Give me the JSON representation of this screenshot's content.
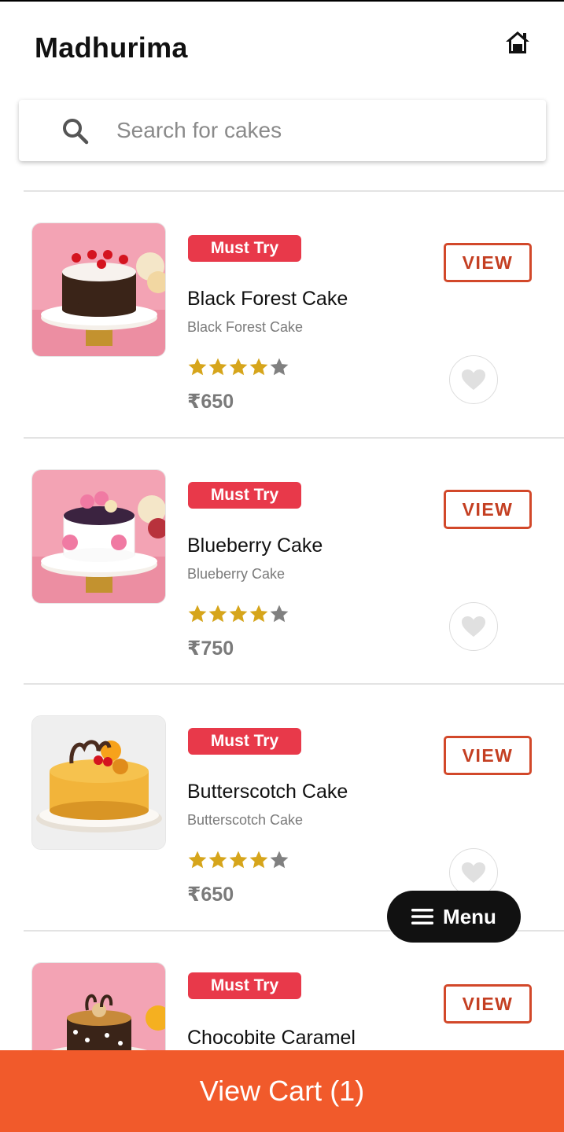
{
  "header": {
    "title": "Madhurima",
    "home_icon": "home-icon"
  },
  "search": {
    "placeholder": "Search for cakes",
    "value": "",
    "icon": "search-icon"
  },
  "colors": {
    "badge": "#e8394a",
    "view_button": "#d2482a",
    "star_filled": "#d6a51b",
    "star_empty": "#808080",
    "cart_bar": "#f15a2b",
    "menu_fab": "#111111"
  },
  "products": [
    {
      "badge": "Must Try",
      "name": "Black Forest Cake",
      "subtitle": "Black Forest Cake",
      "rating": 4,
      "rating_max": 5,
      "price": "₹650",
      "view_label": "VIEW",
      "favorite_icon": "heart-icon"
    },
    {
      "badge": "Must Try",
      "name": "Blueberry Cake",
      "subtitle": "Blueberry Cake",
      "rating": 4,
      "rating_max": 5,
      "price": "₹750",
      "view_label": "VIEW",
      "favorite_icon": "heart-icon"
    },
    {
      "badge": "Must Try",
      "name": "Butterscotch Cake",
      "subtitle": "Butterscotch Cake",
      "rating": 4,
      "rating_max": 5,
      "price": "₹650",
      "view_label": "VIEW",
      "favorite_icon": "heart-icon"
    },
    {
      "badge": "Must Try",
      "name": "Chocobite Caramel",
      "subtitle": "",
      "rating": null,
      "rating_max": 5,
      "price": "",
      "view_label": "VIEW",
      "favorite_icon": "heart-icon"
    }
  ],
  "menu_button": {
    "label": "Menu",
    "icon": "hamburger-icon"
  },
  "cart": {
    "label": "View Cart (1)"
  }
}
